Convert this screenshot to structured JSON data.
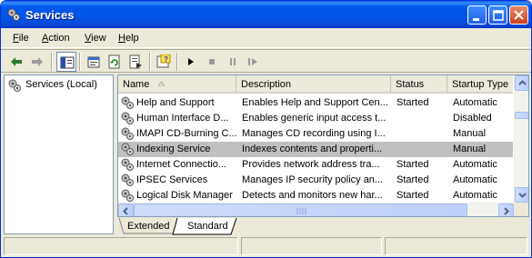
{
  "window": {
    "title": "Services",
    "icon": "gears-icon"
  },
  "menu": [
    {
      "key": "F",
      "rest": "ile"
    },
    {
      "key": "A",
      "rest": "ction"
    },
    {
      "key": "V",
      "rest": "iew"
    },
    {
      "key": "H",
      "rest": "elp"
    }
  ],
  "tree": {
    "root_label": "Services (Local)"
  },
  "list": {
    "columns": [
      "Name",
      "Description",
      "Status",
      "Startup Type"
    ],
    "rows": [
      {
        "name": "Help and Support",
        "description": "Enables Help and Support Cen...",
        "status": "Started",
        "startup": "Automatic"
      },
      {
        "name": "Human Interface D...",
        "description": "Enables generic input access t...",
        "status": "",
        "startup": "Disabled"
      },
      {
        "name": "IMAPI CD-Burning C...",
        "description": "Manages CD recording using I...",
        "status": "",
        "startup": "Manual"
      },
      {
        "name": "Indexing Service",
        "description": "Indexes contents and properti...",
        "status": "",
        "startup": "Manual",
        "selected": true
      },
      {
        "name": "Internet Connectio...",
        "description": "Provides network address tra...",
        "status": "Started",
        "startup": "Automatic"
      },
      {
        "name": "IPSEC Services",
        "description": "Manages IP security policy an...",
        "status": "Started",
        "startup": "Automatic"
      },
      {
        "name": "Logical Disk Manager",
        "description": "Detects and monitors new har...",
        "status": "Started",
        "startup": "Automatic"
      }
    ]
  },
  "tabs": [
    "Extended",
    "Standard"
  ],
  "active_tab": "Standard",
  "colors": {
    "title_bar": "#0055e5",
    "selected_row": "#c0c0c0",
    "face": "#ece9d8"
  }
}
